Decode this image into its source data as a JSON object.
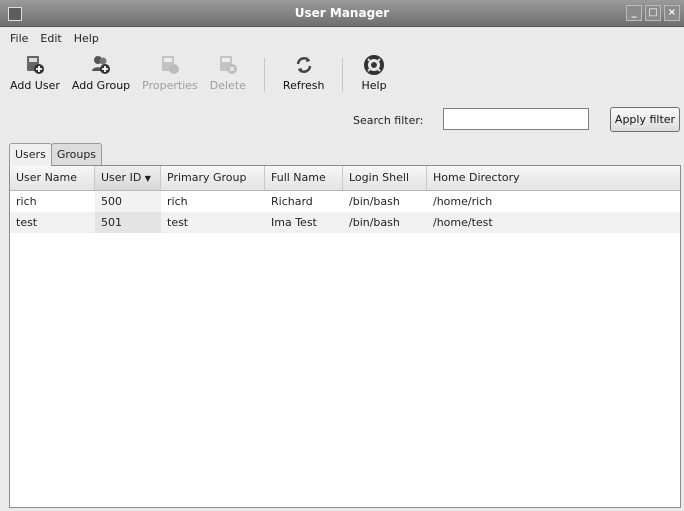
{
  "window": {
    "title": "User Manager",
    "controls": [
      "_",
      "□",
      "×"
    ]
  },
  "menubar": {
    "items": [
      "File",
      "Edit",
      "Help"
    ]
  },
  "toolbar": {
    "buttons": [
      {
        "label": "Add User",
        "icon": "add-user-icon",
        "enabled": true
      },
      {
        "label": "Add Group",
        "icon": "add-group-icon",
        "enabled": true
      },
      {
        "label": "Properties",
        "icon": "properties-icon",
        "enabled": false
      },
      {
        "label": "Delete",
        "icon": "delete-icon",
        "enabled": false
      },
      {
        "label": "Refresh",
        "icon": "refresh-icon",
        "enabled": true
      },
      {
        "label": "Help",
        "icon": "help-icon",
        "enabled": true
      }
    ]
  },
  "filter": {
    "label": "Search filter:",
    "value": "",
    "apply_label": "Apply filter"
  },
  "tabs": [
    {
      "label": "Users",
      "active": true
    },
    {
      "label": "Groups",
      "active": false
    }
  ],
  "table": {
    "columns": [
      "User Name",
      "User ID",
      "Primary Group",
      "Full Name",
      "Login Shell",
      "Home Directory"
    ],
    "sort_column": "User ID",
    "sort_indicator": "▼",
    "rows": [
      [
        "rich",
        "500",
        "rich",
        "Richard",
        "/bin/bash",
        "/home/rich"
      ],
      [
        "test",
        "501",
        "test",
        "Ima Test",
        "/bin/bash",
        "/home/test"
      ]
    ]
  }
}
